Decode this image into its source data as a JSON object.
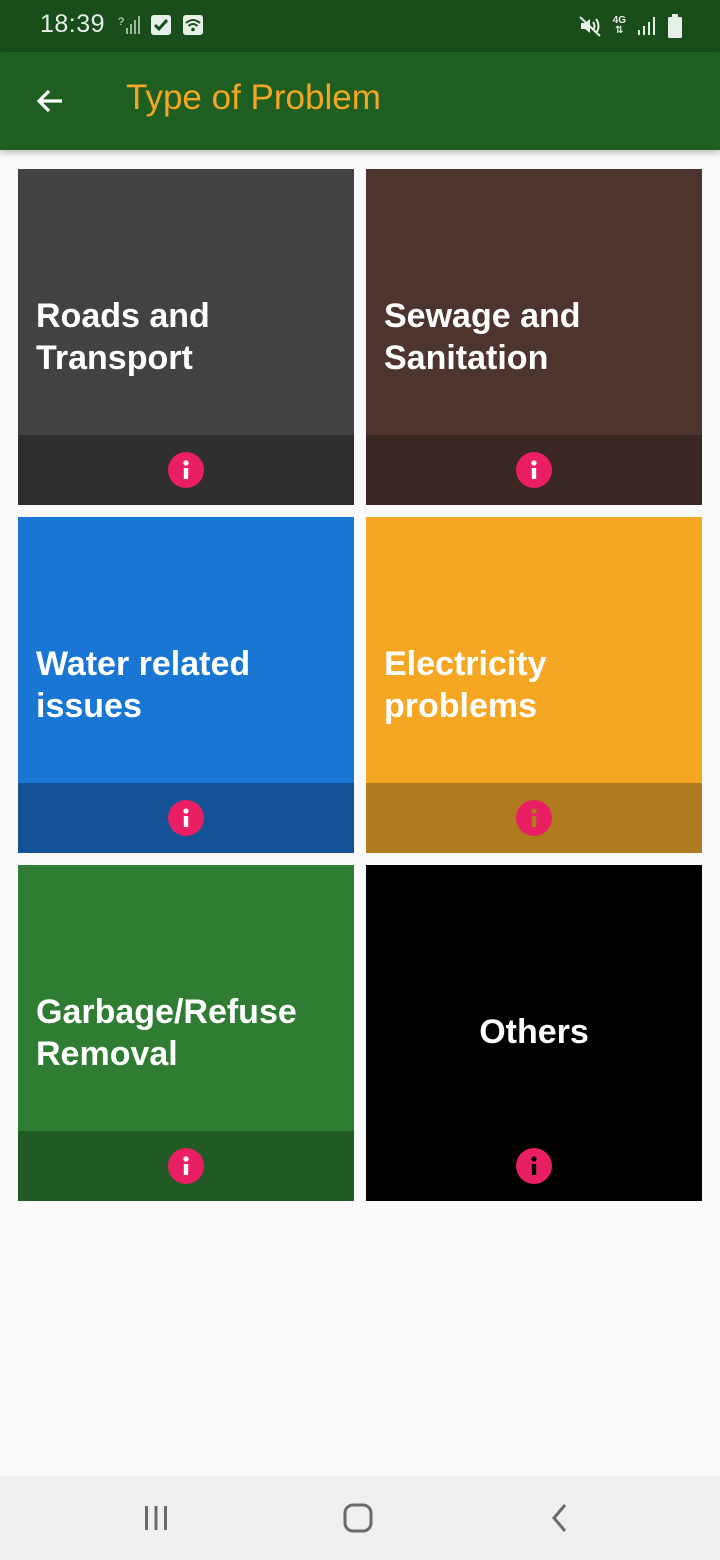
{
  "status_bar": {
    "time": "18:39",
    "left_icons": [
      "signal-unknown-icon",
      "checkbox-notification-icon",
      "wifi-icon"
    ],
    "right_icons": [
      "mute-icon",
      "4g-data-icon",
      "signal-icon",
      "battery-icon"
    ],
    "network_label": "4G"
  },
  "app_bar": {
    "title": "Type of Problem",
    "back_icon": "arrow-back-icon",
    "background": "#1e5e20",
    "title_color": "#f5a623"
  },
  "categories": [
    {
      "label": "Roads and Transport",
      "color": "#424242",
      "footer_color": "#2e2e2e",
      "info_icon": "info-icon"
    },
    {
      "label": "Sewage and Sanitation",
      "color": "#4e342e",
      "footer_color": "#3a2622",
      "info_icon": "info-icon"
    },
    {
      "label": "Water related issues",
      "color": "#1976d2",
      "footer_color": "#125295",
      "info_icon": "info-icon"
    },
    {
      "label": "Electricity problems",
      "color": "#f5a623",
      "footer_color": "#b07a1e",
      "info_icon": "info-icon"
    },
    {
      "label": "Garbage/Refuse Removal",
      "color": "#2e7d32",
      "footer_color": "#215a23",
      "info_icon": "info-icon"
    },
    {
      "label": "Others",
      "color": "#000000",
      "footer_color": "#000000",
      "info_icon": "info-icon"
    }
  ],
  "info_color": "#e91e63",
  "nav_bar": {
    "buttons": [
      "recent-apps-icon",
      "home-icon",
      "back-nav-icon"
    ]
  }
}
